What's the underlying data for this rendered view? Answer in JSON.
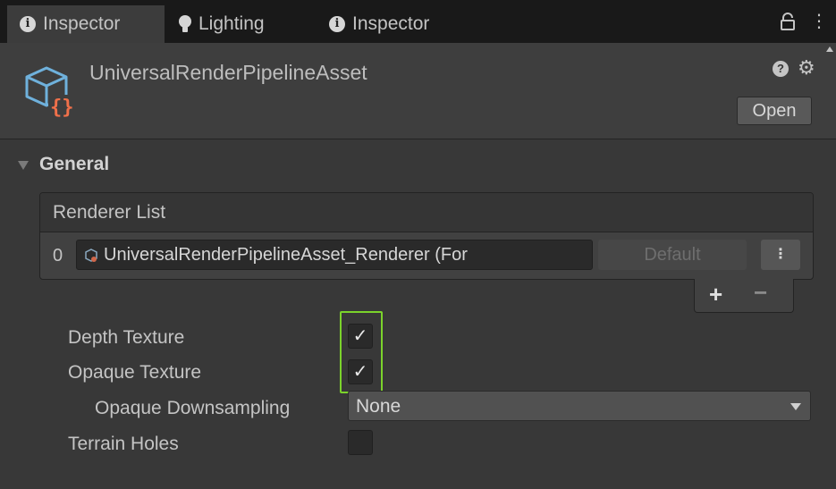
{
  "tabs": [
    {
      "label": "Inspector",
      "icon": "info-icon",
      "active": true
    },
    {
      "label": "Lighting",
      "icon": "lightbulb-icon",
      "active": false
    },
    {
      "label": "Inspector",
      "icon": "info-icon",
      "active": false
    }
  ],
  "window_icons": {
    "lock": "lock-icon",
    "menu": "⋮"
  },
  "header": {
    "title": "UniversalRenderPipelineAsset",
    "open_label": "Open",
    "help_icon": "?",
    "gear_icon": "⚙"
  },
  "section": {
    "title": "General"
  },
  "renderer_list": {
    "header": "Renderer List",
    "rows": [
      {
        "index": "0",
        "value": "UniversalRenderPipelineAsset_Renderer (For",
        "default_label": "Default",
        "menu_glyph": "⋮"
      }
    ],
    "add_label": "+",
    "remove_label": "−"
  },
  "properties": {
    "depth_texture": {
      "label": "Depth Texture",
      "checked": true,
      "glyph": "✓"
    },
    "opaque_texture": {
      "label": "Opaque Texture",
      "checked": true,
      "glyph": "✓"
    },
    "opaque_downsampling": {
      "label": "Opaque Downsampling",
      "value": "None"
    },
    "terrain_holes": {
      "label": "Terrain Holes",
      "checked": false,
      "glyph": ""
    }
  },
  "colors": {
    "background": "#383838",
    "tabbar": "#191919",
    "highlight": "#7bd32b",
    "icon_blue": "#6fb1dc",
    "icon_orange": "#f0704a"
  }
}
